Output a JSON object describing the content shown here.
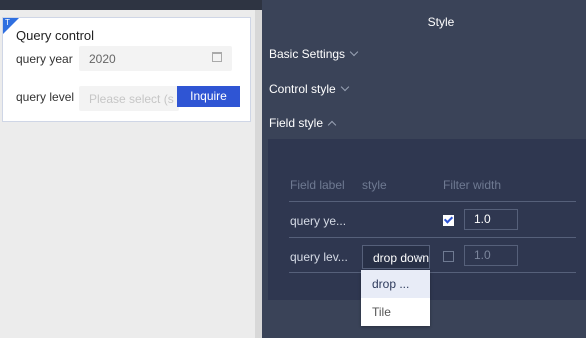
{
  "canvas": {
    "widget": {
      "badge": "T",
      "title": "Query control",
      "rows": [
        {
          "label": "query year",
          "value": "2020",
          "placeholder": ""
        },
        {
          "label": "query level",
          "value": "",
          "placeholder": "Please select (s"
        }
      ],
      "inquire_label": "Inquire"
    }
  },
  "panel": {
    "title": "Style",
    "sections": {
      "basic": "Basic Settings",
      "control": "Control style",
      "field": "Field style"
    },
    "table": {
      "headers": [
        "Field label",
        "style",
        "Filter width"
      ],
      "rows": [
        {
          "label": "query ye...",
          "style": "",
          "checked": true,
          "width": "1.0"
        },
        {
          "label": "query lev...",
          "style": "drop down",
          "checked": false,
          "width": "1.0"
        }
      ]
    },
    "dropdown": {
      "options": [
        "drop ...",
        "Tile"
      ],
      "selected_index": 0
    }
  },
  "colors": {
    "accent": "#2f55d4",
    "panel_bg": "#3a4358",
    "field_bg": "#2f3750"
  }
}
